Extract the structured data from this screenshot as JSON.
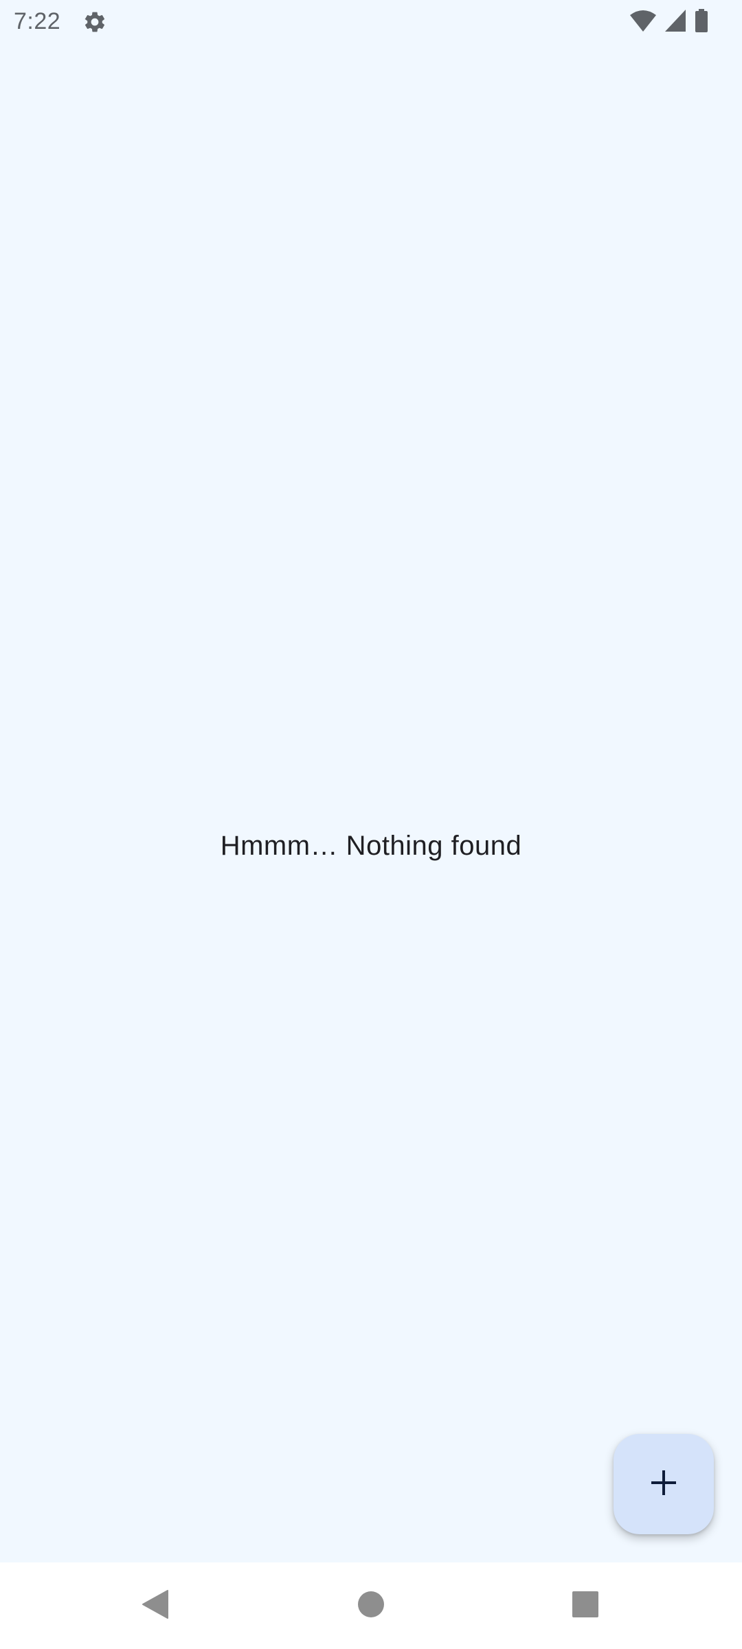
{
  "status_bar": {
    "time": "7:22",
    "icons": [
      "settings-icon",
      "wifi-icon",
      "cellular-signal-icon",
      "battery-icon"
    ]
  },
  "main": {
    "empty_message": "Hmmm… Nothing found"
  },
  "fab": {
    "icon": "plus-icon",
    "color": "#d5e3fa"
  },
  "navigation_bar": {
    "buttons": [
      "back-icon",
      "home-icon",
      "recents-icon"
    ]
  },
  "colors": {
    "background": "#f1f8ff",
    "nav_background": "#ffffff",
    "icon_gray": "#5f6368"
  }
}
